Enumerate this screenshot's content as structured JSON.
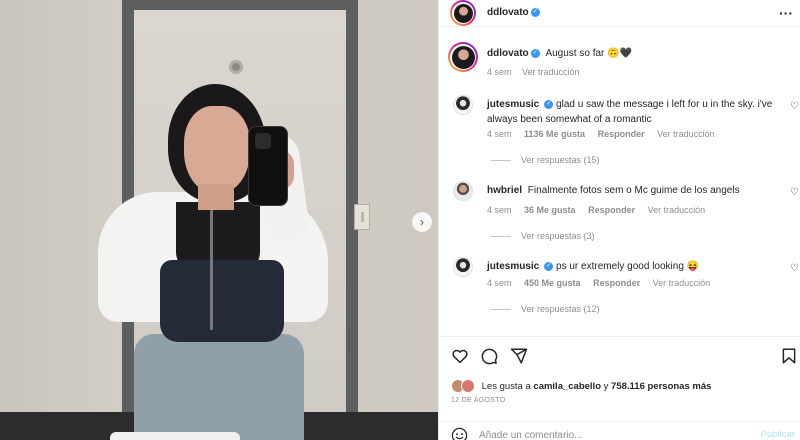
{
  "header": {
    "username": "ddlovato",
    "more_icon": "more-horizontal-icon"
  },
  "caption": {
    "username": "ddlovato",
    "text": "August so far 🙃🖤",
    "time": "4 sem",
    "translate": "Ver traducción"
  },
  "comments": [
    {
      "username": "jutesmusic",
      "verified": true,
      "text": "glad u saw the message i left for u in the sky. i've always been somewhat of a romantic",
      "time": "4 sem",
      "likes": "1136 Me gusta",
      "reply": "Responder",
      "translate": "Ver traducción",
      "replies": "Ver respuestas (15)"
    },
    {
      "username": "hwbriel",
      "verified": false,
      "text": "Finalmente fotos sem o Mc guime de los angels",
      "time": "4 sem",
      "likes": "36 Me gusta",
      "reply": "Responder",
      "translate": "Ver traducción",
      "replies": "Ver respuestas (3)"
    },
    {
      "username": "jutesmusic",
      "verified": true,
      "text": "ps ur extremely good looking 😝",
      "time": "4 sem",
      "likes": "450 Me gusta",
      "reply": "Responder",
      "translate": "Ver traducción",
      "replies": "Ver respuestas (12)"
    }
  ],
  "likes": {
    "prefix": "Les gusta a",
    "user": "camila_cabello",
    "joiner": "y",
    "count": "758.116 personas más"
  },
  "date": "12 DE AGOSTO",
  "add_comment": {
    "placeholder": "Añade un comentario...",
    "post_label": "Publicar"
  },
  "colors": {
    "verified": "#3897f0",
    "muted": "#8e8e8e",
    "post": "#b2dffc"
  }
}
